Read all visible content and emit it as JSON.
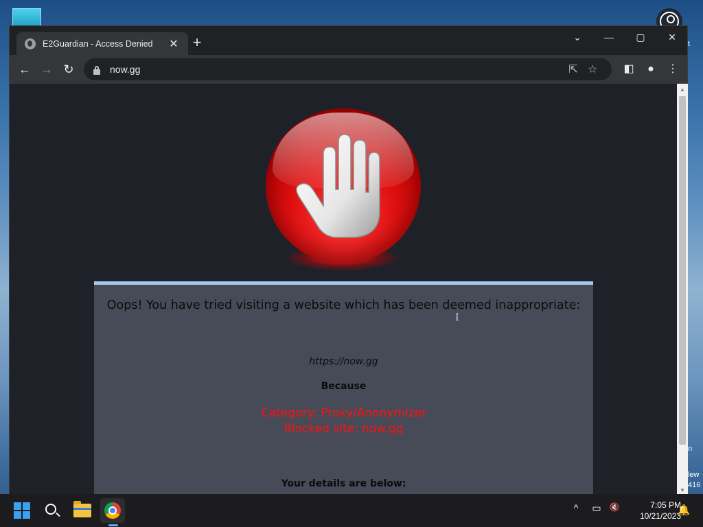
{
  "desktop": {
    "edge_text_top": "t",
    "edge_text_mid": "n",
    "edge_text_new": "lew",
    "edge_text_num": "416"
  },
  "browser": {
    "tab": {
      "title": "E2Guardian - Access Denied",
      "close_glyph": "✕"
    },
    "new_tab_glyph": "+",
    "window_controls": {
      "tab_search": "⌄",
      "minimize": "—",
      "maximize": "▢",
      "close": "✕"
    },
    "toolbar": {
      "back": "←",
      "forward": "→",
      "reload": "↻",
      "url": "now.gg",
      "share": "⇱",
      "bookmark": "☆",
      "side_panel": "◧",
      "profile": "●",
      "menu": "⋮"
    }
  },
  "page": {
    "headline": "Oops! You have tried visiting a website which has been deemed inappropriate:",
    "blocked_url": "https://now.gg",
    "because": "Because",
    "category": "Category: Proxy/Anonymizer",
    "blocked_site": "Blocked site: now.gg",
    "details": "Your details are below:",
    "colors": {
      "reason_red": "#ff1010",
      "box_bg": "#474b57",
      "box_border": "#a9c8ec",
      "page_bg": "#1f2128"
    }
  },
  "taskbar": {
    "apps": [
      "start-icon",
      "search-icon",
      "file-explorer-icon",
      "chrome-icon"
    ],
    "tray": {
      "chevron": "^",
      "network": "▭",
      "volume": "🔇"
    },
    "time": "7:05 PM",
    "date": "10/21/2023",
    "notification": "🔔"
  }
}
